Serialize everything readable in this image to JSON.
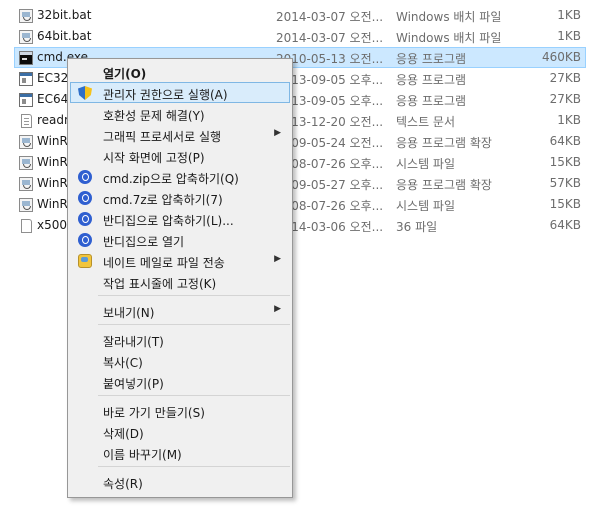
{
  "files": [
    {
      "name": "32bit.bat",
      "date": "2014-03-07 오전...",
      "type": "Windows 배치 파일",
      "size": "1KB",
      "icon": "batch-file-icon"
    },
    {
      "name": "64bit.bat",
      "date": "2014-03-07 오전...",
      "type": "Windows 배치 파일",
      "size": "1KB",
      "icon": "batch-file-icon"
    },
    {
      "name": "cmd.exe",
      "date": "2010-05-13 오전...",
      "type": "응용 프로그램",
      "size": "460KB",
      "icon": "console-app-icon",
      "selected": true
    },
    {
      "name": "EC32.",
      "date": "2013-09-05 오후...",
      "type": "응용 프로그램",
      "size": "27KB",
      "icon": "application-icon"
    },
    {
      "name": "EC64.",
      "date": "2013-09-05 오후...",
      "type": "응용 프로그램",
      "size": "27KB",
      "icon": "application-icon"
    },
    {
      "name": "readm",
      "date": "2013-12-20 오전...",
      "type": "텍스트 문서",
      "size": "1KB",
      "icon": "text-document-icon"
    },
    {
      "name": "WinRi",
      "date": "2009-05-24 오전...",
      "type": "응용 프로그램 확장",
      "size": "64KB",
      "icon": "batch-file-icon"
    },
    {
      "name": "WinRi",
      "date": "2008-07-26 오후...",
      "type": "시스템 파일",
      "size": "15KB",
      "icon": "batch-file-icon"
    },
    {
      "name": "WinRi",
      "date": "2009-05-27 오후...",
      "type": "응용 프로그램 확장",
      "size": "57KB",
      "icon": "batch-file-icon"
    },
    {
      "name": "WinRi",
      "date": "2008-07-26 오후...",
      "type": "시스템 파일",
      "size": "15KB",
      "icon": "batch-file-icon"
    },
    {
      "name": "x500h",
      "date": "2014-03-06 오전...",
      "type": "36 파일",
      "size": "64KB",
      "icon": "blank-file-icon"
    }
  ],
  "context_menu": {
    "items": [
      {
        "label": "열기(O)",
        "bold": true
      },
      {
        "label": "관리자 권한으로 실행(A)",
        "icon": "uac-shield-icon",
        "hover": true
      },
      {
        "label": "호환성 문제 해결(Y)"
      },
      {
        "label": "그래픽 프로세서로 실행",
        "submenu": true
      },
      {
        "label": "시작 화면에 고정(P)"
      },
      {
        "label": "cmd.zip으로 압축하기(Q)",
        "icon": "bandizip-icon"
      },
      {
        "label": "cmd.7z로 압축하기(7)",
        "icon": "bandizip-icon"
      },
      {
        "label": "반디집으로 압축하기(L)...",
        "icon": "bandizip-icon"
      },
      {
        "label": "반디집으로 열기",
        "icon": "bandizip-icon"
      },
      {
        "label": "네이트 메일로 파일 전송",
        "icon": "nate-mail-icon",
        "submenu": true
      },
      {
        "label": "작업 표시줄에 고정(K)"
      },
      {
        "separator": true
      },
      {
        "label": "보내기(N)",
        "submenu": true
      },
      {
        "separator": true
      },
      {
        "label": "잘라내기(T)"
      },
      {
        "label": "복사(C)"
      },
      {
        "label": "붙여넣기(P)"
      },
      {
        "separator": true
      },
      {
        "label": "바로 가기 만들기(S)"
      },
      {
        "label": "삭제(D)"
      },
      {
        "label": "이름 바꾸기(M)"
      },
      {
        "separator": true
      },
      {
        "label": "속성(R)"
      }
    ]
  }
}
